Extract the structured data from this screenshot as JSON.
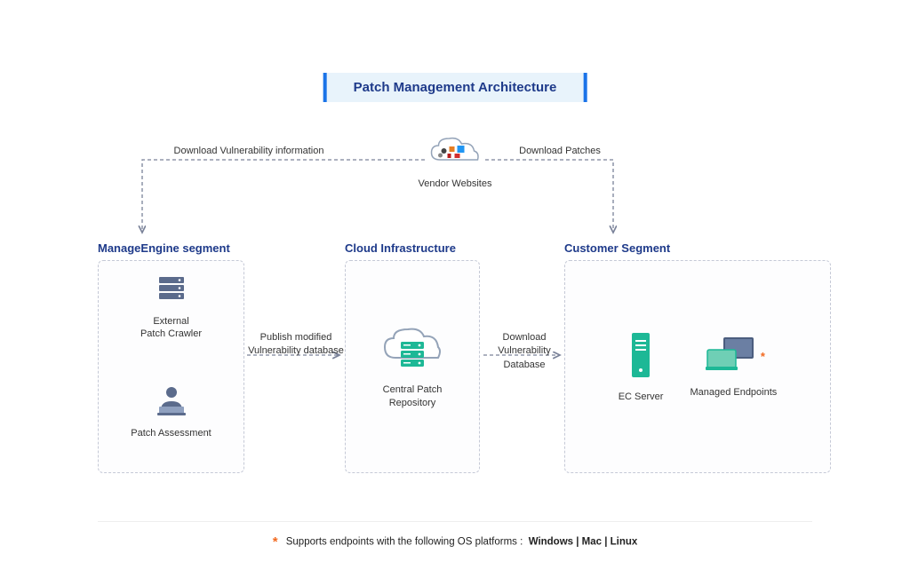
{
  "title": "Patch Management Architecture",
  "vendor": {
    "label": "Vendor Websites"
  },
  "flows": {
    "download_vuln": "Download Vulnerability information",
    "download_patches": "Download Patches",
    "publish_db": "Publish modified\nVulnerability database",
    "download_db": "Download\nVulnerability Database"
  },
  "segments": {
    "manageengine": {
      "title": "ManageEngine segment",
      "nodes": {
        "crawler": "External\nPatch Crawler",
        "assessment": "Patch Assessment"
      }
    },
    "cloud": {
      "title": "Cloud Infrastructure",
      "nodes": {
        "repo": "Central Patch\nRepository"
      }
    },
    "customer": {
      "title": "Customer Segment",
      "nodes": {
        "ec": "EC Server",
        "endpoints": "Managed Endpoints"
      }
    }
  },
  "footer": {
    "prefix": "Supports endpoints with the following OS platforms :",
    "platforms": "Windows  |  Mac  |  Linux"
  }
}
